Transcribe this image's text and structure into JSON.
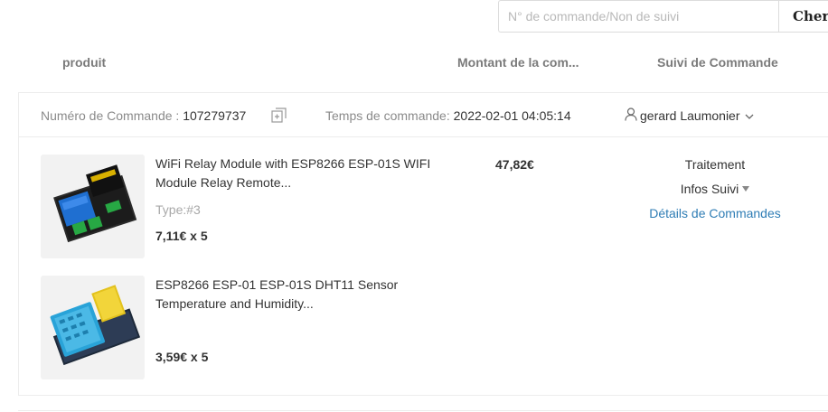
{
  "search": {
    "placeholder": "N° de commande/Non de suivi",
    "button_label": "Cher"
  },
  "columns": {
    "product": "produit",
    "amount": "Montant de la com...",
    "tracking": "Suivi de Commande"
  },
  "order": {
    "number_label": "Numéro de Commande : ",
    "number": "107279737",
    "time_label": "Temps de commande: ",
    "time": "2022-02-01 04:05:14",
    "buyer": "gerard Laumonier",
    "amount": "47,82€",
    "status": "Traitement",
    "tracking_label": "Infos Suivi",
    "details_label": "Détails de Commandes",
    "items": [
      {
        "name": "WiFi Relay Module with ESP8266 ESP-01S WIFI Module Relay Remote...",
        "type": "Type:#3",
        "price": "7,11€ x 5"
      },
      {
        "name": "ESP8266 ESP-01 ESP-01S DHT11 Sensor Temperature and Humidity...",
        "type": "",
        "price": "3,59€ x 5"
      }
    ]
  },
  "icons": [
    "copy-icon",
    "user-icon",
    "caret-down-icon",
    "chevron-down-icon"
  ],
  "colors": {
    "link": "#2f7db5",
    "border": "#ececec",
    "muted": "#8a8a8a"
  }
}
